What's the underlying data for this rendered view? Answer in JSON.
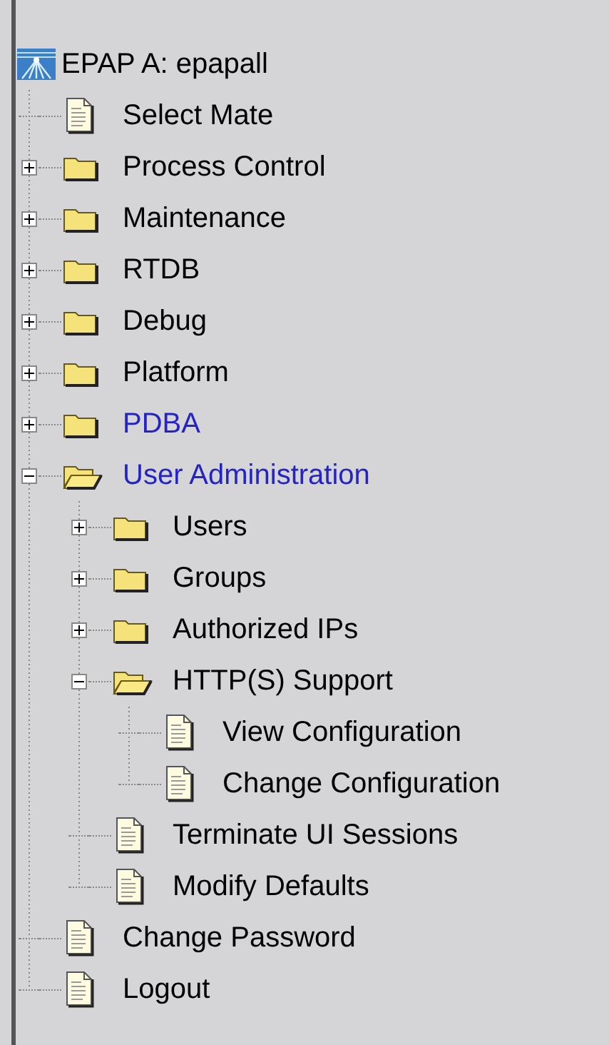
{
  "tree": {
    "label": "EPAP A: epapall",
    "children": [
      {
        "label": "Select Mate",
        "kind": "document",
        "visited": false
      },
      {
        "label": "Process Control",
        "kind": "folder",
        "expanded": false,
        "visited": false
      },
      {
        "label": "Maintenance",
        "kind": "folder",
        "expanded": false,
        "visited": false
      },
      {
        "label": "RTDB",
        "kind": "folder",
        "expanded": false,
        "visited": false
      },
      {
        "label": "Debug",
        "kind": "folder",
        "expanded": false,
        "visited": false
      },
      {
        "label": "Platform",
        "kind": "folder",
        "expanded": false,
        "visited": false
      },
      {
        "label": "PDBA",
        "kind": "folder",
        "expanded": false,
        "visited": true
      },
      {
        "label": "User Administration",
        "kind": "folder",
        "expanded": true,
        "visited": true,
        "children": [
          {
            "label": "Users",
            "kind": "folder",
            "expanded": false,
            "visited": false
          },
          {
            "label": "Groups",
            "kind": "folder",
            "expanded": false,
            "visited": false
          },
          {
            "label": "Authorized IPs",
            "kind": "folder",
            "expanded": false,
            "visited": false
          },
          {
            "label": "HTTP(S) Support",
            "kind": "folder",
            "expanded": true,
            "visited": false,
            "children": [
              {
                "label": "View Configuration",
                "kind": "document",
                "visited": false
              },
              {
                "label": "Change Configuration",
                "kind": "document",
                "visited": false
              }
            ]
          },
          {
            "label": "Terminate UI Sessions",
            "kind": "document",
            "visited": false
          },
          {
            "label": "Modify Defaults",
            "kind": "document",
            "visited": false
          }
        ]
      },
      {
        "label": "Change Password",
        "kind": "document",
        "visited": false
      },
      {
        "label": "Logout",
        "kind": "document",
        "visited": false
      }
    ]
  }
}
